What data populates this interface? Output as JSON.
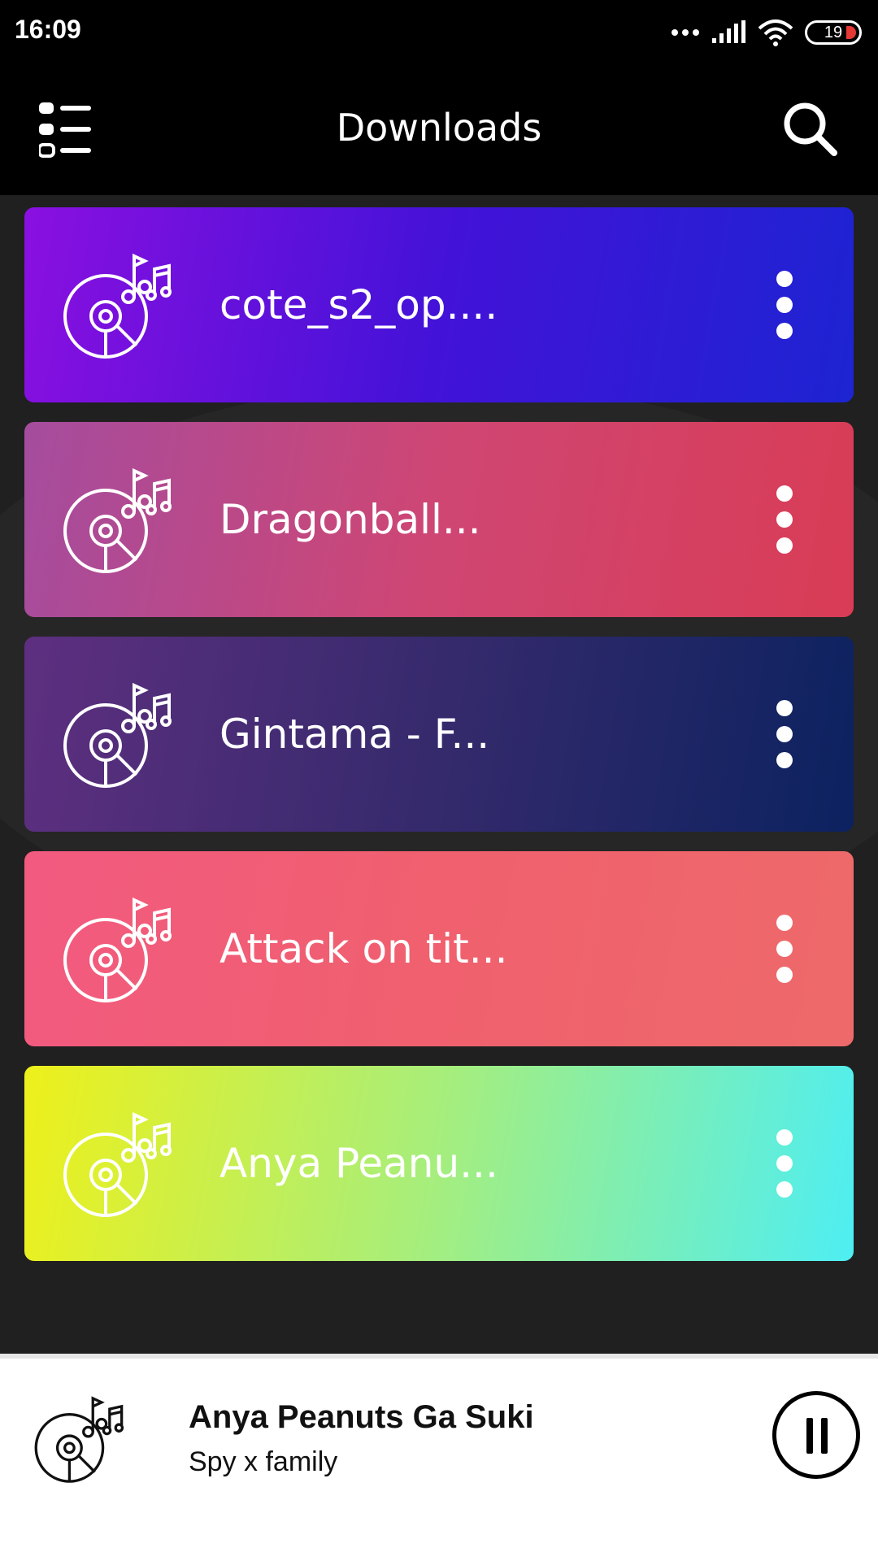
{
  "status_bar": {
    "time": "16:09",
    "battery": "19",
    "battery_color": "#e53935",
    "icons": [
      "dots-icon",
      "signal-icon",
      "wifi-icon",
      "battery-icon"
    ]
  },
  "header": {
    "title": "Downloads",
    "menu_icon": "list-menu-icon",
    "search_icon": "search-icon"
  },
  "downloads": [
    {
      "title": "cote_s2_op....",
      "gradient": [
        "#8a10e0",
        "#4312d8",
        "#1d24d2"
      ]
    },
    {
      "title": "Dragonball...",
      "gradient": [
        "#a54c9e",
        "#cf4673",
        "#d93c55"
      ]
    },
    {
      "title": "Gintama - F...",
      "gradient": [
        "#5e2f80",
        "#352a6c",
        "#0c2260"
      ]
    },
    {
      "title": "Attack on tit...",
      "gradient": [
        "#f25a80",
        "#f0606e",
        "#ee6a6a"
      ]
    },
    {
      "title": "Anya Peanu...",
      "gradient": [
        "#eef01a",
        "#a5ee7e",
        "#4eeef3"
      ]
    }
  ],
  "now_playing": {
    "title": "Anya Peanuts Ga Suki",
    "subtitle": "Spy x family",
    "control_icon": "pause-icon"
  }
}
